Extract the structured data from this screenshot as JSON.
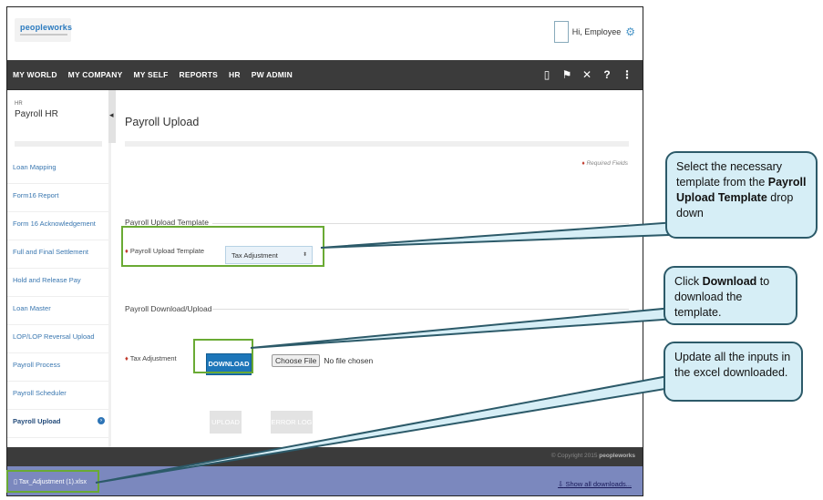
{
  "brand": {
    "logo_text": "peopleworks"
  },
  "user": {
    "greeting": "Hi, Employee"
  },
  "nav": {
    "items": [
      "MY WORLD",
      "MY COMPANY",
      "MY SELF",
      "REPORTS",
      "HR",
      "PW ADMIN"
    ],
    "icons": [
      "book-icon",
      "flag-icon",
      "tools-icon",
      "help-icon",
      "share-icon"
    ]
  },
  "sidebar": {
    "section_label": "HR",
    "title": "Payroll HR",
    "items": [
      {
        "label": "Loan Mapping"
      },
      {
        "label": "Form16 Report"
      },
      {
        "label": "Form 16 Acknowledgement"
      },
      {
        "label": "Full and Final Settlement"
      },
      {
        "label": "Hold and Release Pay"
      },
      {
        "label": "Loan Master"
      },
      {
        "label": "LOP/LOP Reversal Upload"
      },
      {
        "label": "Payroll Process"
      },
      {
        "label": "Payroll Scheduler"
      },
      {
        "label": "Payroll Upload",
        "active": true
      }
    ]
  },
  "main": {
    "title": "Payroll Upload",
    "required_note": "Required Fields",
    "template_section": "Payroll Upload Template",
    "template_label": "Payroll Upload Template",
    "template_value": "Tax Adjustment",
    "download_section": "Payroll Download/Upload",
    "tax_label": "Tax Adjustment",
    "download_button": "DOWNLOAD",
    "choose_file_button": "Choose File",
    "no_file": "No file chosen",
    "upload_button": "UPLOAD",
    "error_log_button": "ERROR LOG"
  },
  "footer": {
    "copyright": "© Copyright 2015",
    "brand": "peopleworks"
  },
  "downloads": {
    "file": "Tax_Adjustment (1).xlsx",
    "show_all": "Show all downloads..."
  },
  "callouts": {
    "c1_pre": "Select the necessary template from the ",
    "c1_bold": "Payroll Upload Template",
    "c1_post": " drop down",
    "c2_pre": "Click ",
    "c2_bold": "Download",
    "c2_post": " to download the template.",
    "c3": "Update all the inputs in the excel downloaded."
  },
  "colors": {
    "accent": "#1d76b9",
    "nav": "#3b3b3b",
    "highlight": "#6aaa34",
    "callout_bg": "#d6eef6",
    "download_bar": "#7b88be"
  }
}
